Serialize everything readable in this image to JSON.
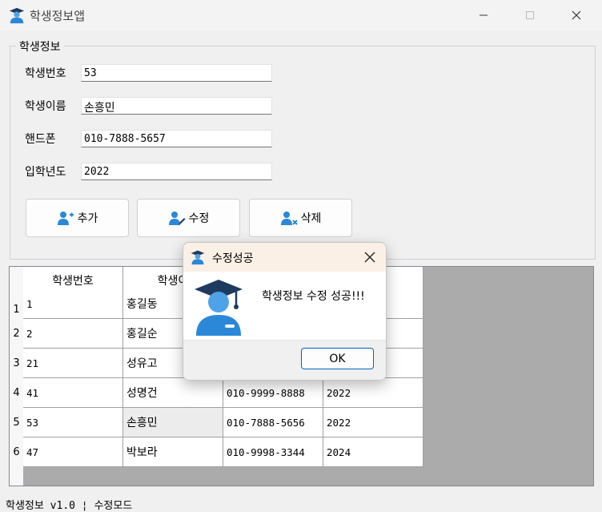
{
  "window": {
    "title": "학생정보앱"
  },
  "form": {
    "group_label": "학생정보",
    "fields": [
      {
        "label": "학생번호",
        "value": "53"
      },
      {
        "label": "학생이름",
        "value": "손흥민"
      },
      {
        "label": "핸드폰",
        "value": "010-7888-5657"
      },
      {
        "label": "입학년도",
        "value": "2022"
      }
    ],
    "buttons": [
      {
        "label": "추가"
      },
      {
        "label": "수정"
      },
      {
        "label": "삭제"
      }
    ]
  },
  "table": {
    "headers": [
      "학생번호",
      "학생이",
      "",
      "도"
    ],
    "rows": [
      {
        "num": "1",
        "cells": [
          "1",
          "홍길동",
          "",
          ""
        ]
      },
      {
        "num": "2",
        "cells": [
          "2",
          "홍길순",
          "",
          ""
        ]
      },
      {
        "num": "3",
        "cells": [
          "21",
          "성유고",
          "",
          ""
        ]
      },
      {
        "num": "4",
        "cells": [
          "41",
          "성명건",
          "010-9999-8888",
          "2022"
        ]
      },
      {
        "num": "5",
        "cells": [
          "53",
          "손흥민",
          "010-7888-5656",
          "2022"
        ]
      },
      {
        "num": "6",
        "cells": [
          "47",
          "박보라",
          "010-9998-3344",
          "2024"
        ]
      }
    ]
  },
  "dialog": {
    "title": "수정성공",
    "message": "학생정보 수정 성공!!!",
    "ok_label": "OK"
  },
  "status": {
    "text": "학생정보 v1.0 ¦ 수정모드"
  },
  "colors": {
    "accent": "#2b88d8",
    "dialog_title_bg": "#faf0e6",
    "ok_border": "#0067c0"
  },
  "icons": [
    "student-icon",
    "add-user-icon",
    "edit-user-icon",
    "delete-user-icon",
    "close-icon",
    "minimize-icon",
    "maximize-icon"
  ]
}
